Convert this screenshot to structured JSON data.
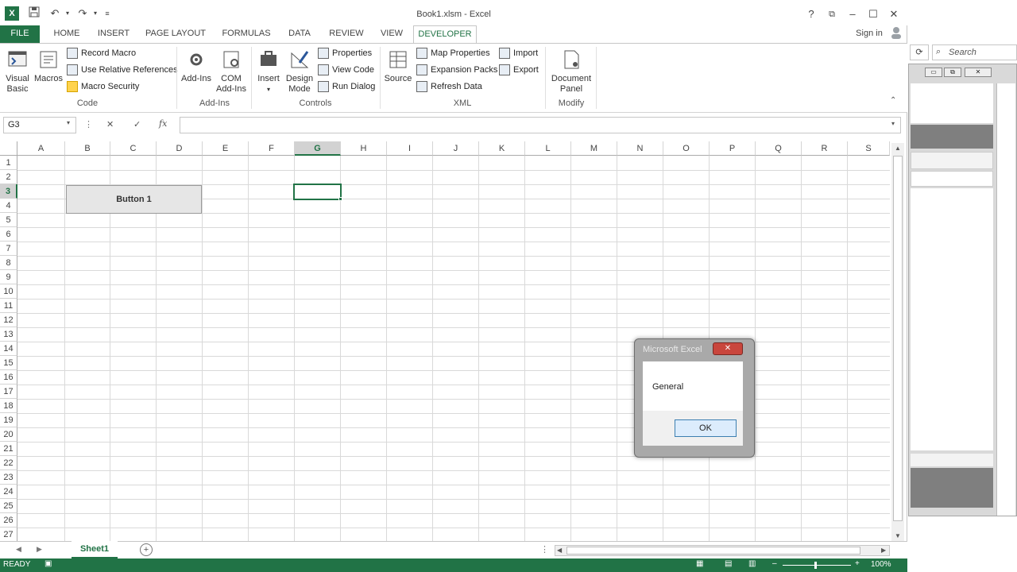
{
  "app": {
    "window_title": "Book1.xlsm - Excel",
    "sign_in": "Sign in"
  },
  "tabs": [
    {
      "label": "FILE"
    },
    {
      "label": "HOME"
    },
    {
      "label": "INSERT"
    },
    {
      "label": "PAGE LAYOUT"
    },
    {
      "label": "FORMULAS"
    },
    {
      "label": "DATA"
    },
    {
      "label": "REVIEW"
    },
    {
      "label": "VIEW"
    },
    {
      "label": "DEVELOPER"
    }
  ],
  "ribbon": {
    "code": {
      "visual_basic_1": "Visual",
      "visual_basic_2": "Basic",
      "macros": "Macros",
      "record_macro": "Record Macro",
      "use_relative": "Use Relative References",
      "macro_security": "Macro Security",
      "group": "Code"
    },
    "addins": {
      "addins": "Add-Ins",
      "com_1": "COM",
      "com_2": "Add-Ins",
      "group": "Add-Ins"
    },
    "controls": {
      "insert": "Insert",
      "design_1": "Design",
      "design_2": "Mode",
      "properties": "Properties",
      "view_code": "View Code",
      "run_dialog": "Run Dialog",
      "group": "Controls"
    },
    "xml": {
      "source": "Source",
      "map_properties": "Map Properties",
      "expansion_packs": "Expansion Packs",
      "refresh_data": "Refresh Data",
      "import": "Import",
      "export": "Export",
      "group": "XML"
    },
    "modify": {
      "doc_1": "Document",
      "doc_2": "Panel",
      "group": "Modify"
    }
  },
  "formula_bar": {
    "name_box": "G3",
    "cancel": "✕",
    "enter": "✓",
    "fx": "fx",
    "content": ""
  },
  "sheet": {
    "columns": [
      "A",
      "B",
      "C",
      "D",
      "E",
      "F",
      "G",
      "H",
      "I",
      "J",
      "K",
      "L",
      "M",
      "N",
      "O",
      "P",
      "Q",
      "R",
      "S"
    ],
    "rows": [
      "1",
      "2",
      "3",
      "4",
      "5",
      "6",
      "7",
      "8",
      "9",
      "10",
      "11",
      "12",
      "13",
      "14",
      "15",
      "16",
      "17",
      "18",
      "19",
      "20",
      "21",
      "22",
      "23",
      "24",
      "25",
      "26",
      "27"
    ],
    "selected_cell": "G3",
    "form_button": "Button 1",
    "tab": "Sheet1"
  },
  "msgbox": {
    "title": "Microsoft Excel",
    "message": "General",
    "ok": "OK"
  },
  "status": {
    "mode": "READY",
    "zoom": "100%"
  },
  "vbe": {
    "search_placeholder": "Search"
  }
}
